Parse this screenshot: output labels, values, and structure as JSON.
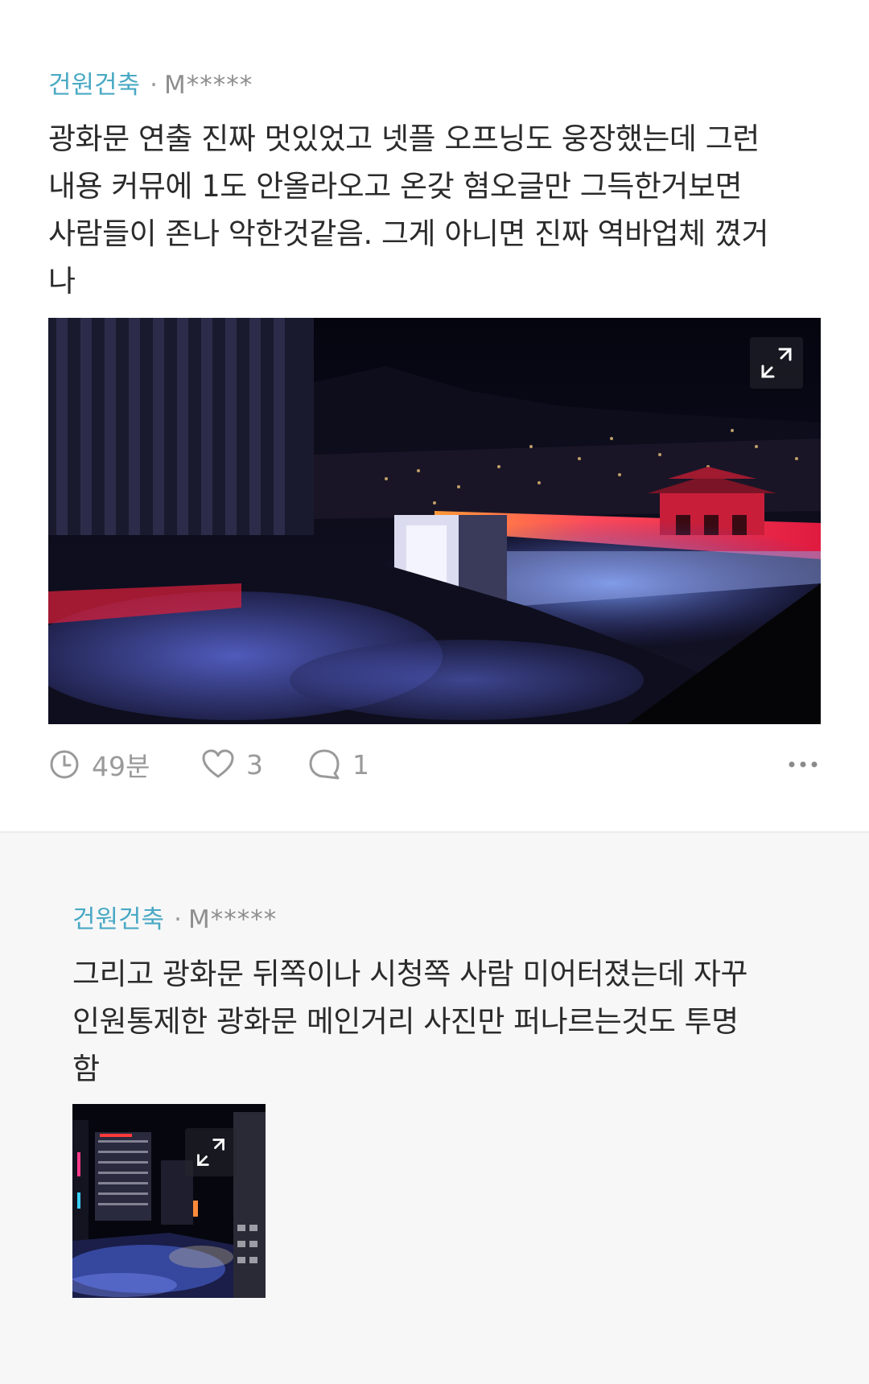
{
  "post": {
    "company": "건원건축",
    "separator": "·",
    "user": "M*****",
    "lines": [
      "광화문 연출 진짜 멋있었고 넷플 오프닝도 웅장했는데 그런",
      "내용 커뮤에 1도 안올라오고 온갖 혐오글만 그득한거보면",
      "사람들이 존나 악한것같음. 그게 아니면 진짜 역바업체 꼈거",
      "나"
    ],
    "image_icon": "expand-icon",
    "time": "49분",
    "likes": "3",
    "comments": "1"
  },
  "comment": {
    "company": "건원건축",
    "separator": "·",
    "user": "M*****",
    "lines": [
      "그리고 광화문 뒤쪽이나 시청쪽 사람 미어터졌는데 자꾸",
      "인원통제한 광화문 메인거리 사진만 퍼나르는것도 투명",
      "함"
    ],
    "image_icon": "expand-icon"
  },
  "colors": {
    "company": "#4aa9c4",
    "meta_gray": "#8e8e8e",
    "text": "#2b2b2b",
    "comment_bg": "#f7f7f8"
  }
}
